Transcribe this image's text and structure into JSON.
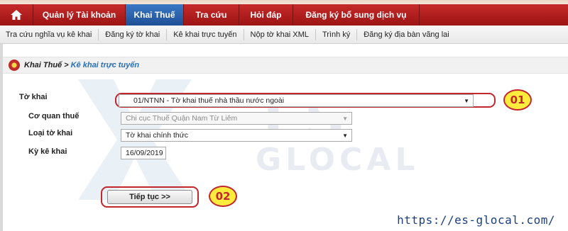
{
  "nav": {
    "items": [
      {
        "label": "Quản lý Tài khoản",
        "active": false
      },
      {
        "label": "Khai Thuế",
        "active": true
      },
      {
        "label": "Tra cứu",
        "active": false
      },
      {
        "label": "Hỏi đáp",
        "active": false
      },
      {
        "label": "Đăng ký bổ sung dịch vụ",
        "active": false
      }
    ]
  },
  "subnav": {
    "items": [
      "Tra cứu nghĩa vụ kê khai",
      "Đăng ký tờ khai",
      "Kê khai trực tuyến",
      "Nộp tờ khai XML",
      "Trình ký",
      "Đăng ký địa bàn vãng lai"
    ]
  },
  "breadcrumb": {
    "section": "Khai Thuế",
    "separator": ">",
    "page": "Kê khai trực tuyến"
  },
  "form": {
    "to_khai_label": "Tờ khai",
    "to_khai_value": "01/NTNN - Tờ khai thuế nhà thầu nước ngoài",
    "co_quan_label": "Cơ quan thuế",
    "co_quan_value": "Chi cục Thuế Quận Nam Từ Liêm",
    "loai_label": "Loại tờ khai",
    "loai_value": "Tờ khai chính thức",
    "ky_label": "Kỳ kê khai",
    "ky_value": "16/09/2019"
  },
  "continue_button": "Tiếp tục >>",
  "annotations": {
    "step1": "01",
    "step2": "02"
  },
  "watermark": {
    "big": "ES",
    "small": "GLOCAL"
  },
  "footer_url": "https://es-glocal.com/",
  "colors": {
    "nav_red": "#b71c1c",
    "nav_active": "#2e63ad",
    "highlight": "#c1272d",
    "badge": "#ffec3d"
  }
}
